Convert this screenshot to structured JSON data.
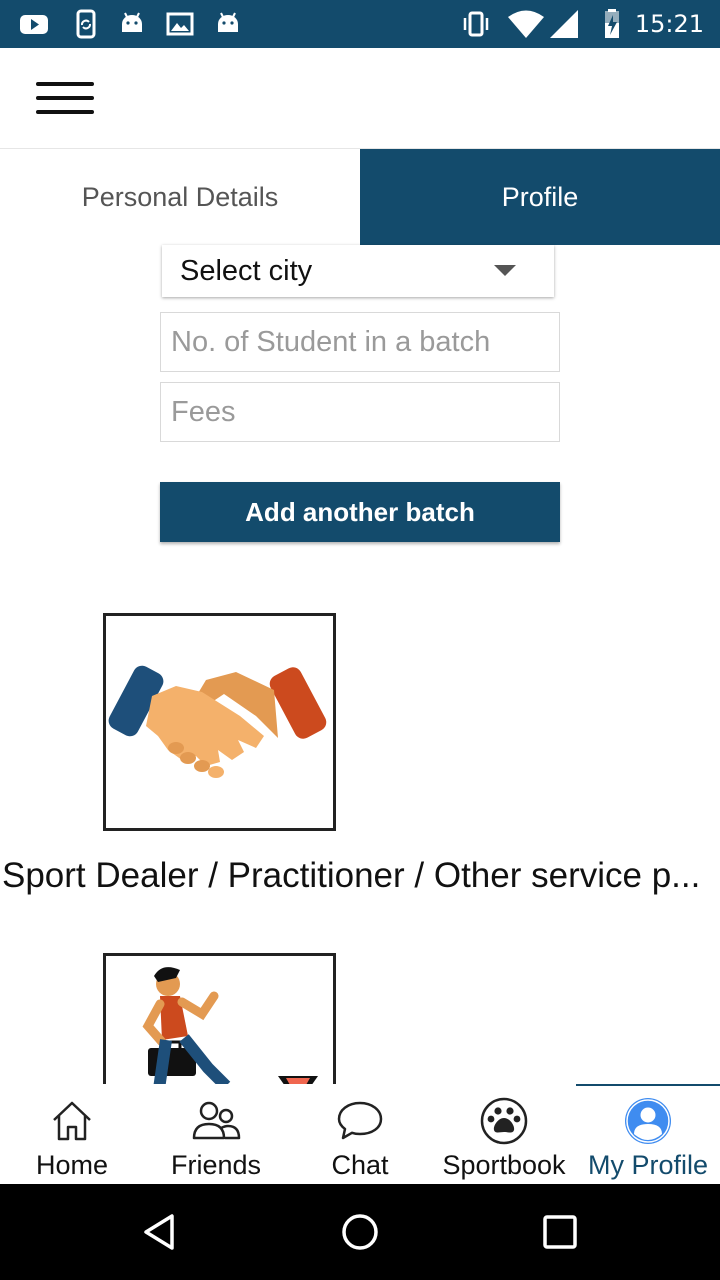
{
  "status_bar": {
    "time": "15:21",
    "left_icons": [
      "youtube-icon",
      "phone-sync-icon",
      "android-icon",
      "image-icon",
      "android-icon"
    ],
    "right_icons": [
      "vibrate-icon",
      "wifi-icon",
      "signal-icon",
      "battery-charging-icon"
    ],
    "background": "#134b6c"
  },
  "header": {
    "menu_icon": "hamburger-icon"
  },
  "tabs": [
    {
      "label": "Personal Details",
      "active": false
    },
    {
      "label": "Profile",
      "active": true
    }
  ],
  "form": {
    "city_select": {
      "value": "Select city"
    },
    "students_input": {
      "placeholder": "No. of Student in a batch",
      "value": ""
    },
    "fees_input": {
      "placeholder": "Fees",
      "value": ""
    },
    "add_batch_label": "Add another batch"
  },
  "categories": [
    {
      "label": "Sport Dealer / Practitioner / Other service p...",
      "icon": "handshake-icon"
    },
    {
      "label": "",
      "icon": "businessman-walking-icon"
    }
  ],
  "bottom_nav": [
    {
      "label": "Home",
      "icon": "home-icon",
      "active": false
    },
    {
      "label": "Friends",
      "icon": "friends-icon",
      "active": false
    },
    {
      "label": "Chat",
      "icon": "chat-bubble-icon",
      "active": false
    },
    {
      "label": "Sportbook",
      "icon": "paw-icon",
      "active": false
    },
    {
      "label": "My Profile",
      "icon": "user-profile-icon",
      "active": true
    }
  ],
  "colors": {
    "primary": "#134b6c",
    "active_icon": "#3f8cf0"
  }
}
